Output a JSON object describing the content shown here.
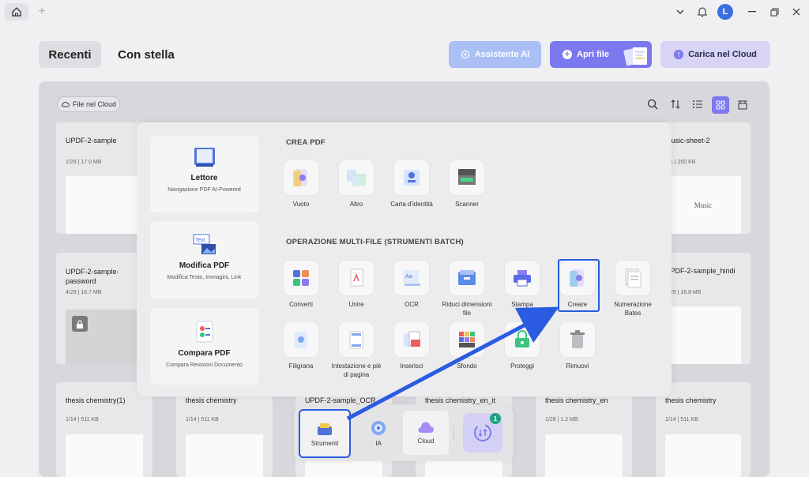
{
  "titlebar": {
    "avatar_letter": "L"
  },
  "tabs": {
    "recent": "Recenti",
    "starred": "Con stella"
  },
  "actions": {
    "ai": "Assistente AI",
    "open": "Apri file",
    "cloud": "Carica nel Cloud"
  },
  "cloud_files": "File nel Cloud",
  "files": [
    {
      "name": "UPDF-2-sample",
      "meta": "1/29 | 17.0 MB"
    },
    {
      "name": "music-sheet-2",
      "meta": "1/1 | 250 KB",
      "thumb_text": "Music"
    },
    {
      "name": "UPDF-2-sample-password",
      "meta": "4/29 | 16.7 MB"
    },
    {
      "name": "UPDF-2-sample_hindi",
      "meta": "1/29 | 16.8 MB"
    },
    {
      "name": "thesis chemistry(1)",
      "meta": "1/14 | 511 KB"
    },
    {
      "name": "thesis chemistry",
      "meta": "1/14 | 511 KB"
    },
    {
      "name": "UPDF-2-sample_OCR",
      "meta": ""
    },
    {
      "name": "thesis chemistry_en_it",
      "meta": ""
    },
    {
      "name": "thesis chemistry_en",
      "meta": "1/28 | 1.2 MB"
    },
    {
      "name": "thesis chemistry",
      "meta": "1/14 | 511 KB"
    }
  ],
  "overlay": {
    "side": [
      {
        "title": "Lettore",
        "sub": "Navigazione PDF AI-Powered"
      },
      {
        "title": "Modifica PDF",
        "sub": "Modifica Testo, Immagini, Link"
      },
      {
        "title": "Compara PDF",
        "sub": "Compara Revisioni Documento"
      }
    ],
    "create_title": "CREA PDF",
    "create_tools": [
      "Vuoto",
      "Altro",
      "Carta d'identità",
      "Scanner"
    ],
    "batch_title": "OPERAZIONE MULTI-FILE (STRUMENTI BATCH)",
    "batch_tools": [
      "Converti",
      "Unire",
      "OCR",
      "Riduci dimensioni file",
      "Stampa",
      "Creare",
      "Numerazione Bates",
      "Filigrana",
      "Intestazione e piè di pagina",
      "Inserisci",
      "Sfondo",
      "Proteggi",
      "Rimuovi"
    ]
  },
  "dock": {
    "tools": "Strumenti",
    "ai": "IA",
    "cloud": "Cloud",
    "badge": "1"
  },
  "colors": {
    "accent": "#7b78f0",
    "highlight": "#2a5be0"
  }
}
